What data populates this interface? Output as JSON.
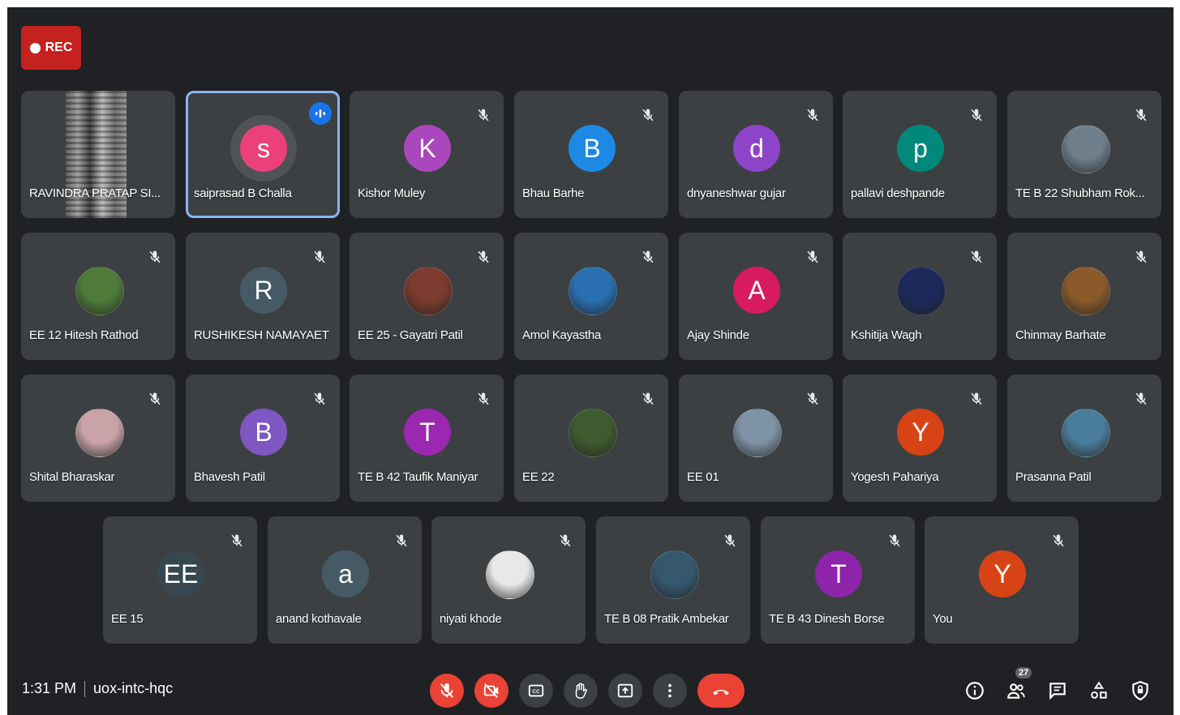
{
  "recording": {
    "label": "REC"
  },
  "participants": [
    {
      "name": "RAVINDRA PRATAP SI...",
      "type": "photo"
    },
    {
      "name": "saiprasad B Challa",
      "initial": "s",
      "color": "#ec407a",
      "speaking": true
    },
    {
      "name": "Kishor Muley",
      "initial": "K",
      "color": "#ab47bc"
    },
    {
      "name": "Bhau Barhe",
      "initial": "B",
      "color": "#1e88e5"
    },
    {
      "name": "dnyaneshwar gujar",
      "initial": "d",
      "color": "#8e44c8"
    },
    {
      "name": "pallavi deshpande",
      "initial": "p",
      "color": "#00897b"
    },
    {
      "name": "TE B 22 Shubham Rok...",
      "type": "pic",
      "pic": "#6f7f8c"
    },
    {
      "name": "EE 12 Hitesh Rathod",
      "type": "pic",
      "pic": "#4e7a3a"
    },
    {
      "name": "RUSHIKESH NAMAYAET",
      "initial": "R",
      "color": "#455a64"
    },
    {
      "name": "EE 25 - Gayatri Patil",
      "type": "pic",
      "pic": "#7b3b2e"
    },
    {
      "name": "Amol Kayastha",
      "type": "pic",
      "pic": "#2a6fb0"
    },
    {
      "name": "Ajay Shinde",
      "initial": "A",
      "color": "#d81b60"
    },
    {
      "name": "Kshitija Wagh",
      "type": "pic",
      "pic": "#1b2a5a"
    },
    {
      "name": "Chinmay Barhate",
      "type": "pic",
      "pic": "#8a5a2b"
    },
    {
      "name": "Shital Bharaskar",
      "type": "pic",
      "pic": "#c9a3a8"
    },
    {
      "name": "Bhavesh Patil",
      "initial": "B",
      "color": "#7e57c2"
    },
    {
      "name": "TE B 42 Taufik Maniyar",
      "initial": "T",
      "color": "#9c27b0"
    },
    {
      "name": "EE 22",
      "type": "pic",
      "pic": "#3e5a2f"
    },
    {
      "name": "EE 01",
      "type": "pic",
      "pic": "#7f93a6"
    },
    {
      "name": "Yogesh Pahariya",
      "initial": "Y",
      "color": "#d84315"
    },
    {
      "name": "Prasanna Patil",
      "type": "pic",
      "pic": "#4a7d9a"
    },
    {
      "name": "EE 15",
      "initial": "EE",
      "color": "#37474f"
    },
    {
      "name": "anand kothavale",
      "initial": "a",
      "color": "#455a64"
    },
    {
      "name": "niyati khode",
      "type": "pic",
      "pic": "#e8e8e8"
    },
    {
      "name": "TE B 08 Pratik Ambekar",
      "type": "pic",
      "pic": "#35586e"
    },
    {
      "name": "TE B 43 Dinesh Borse",
      "initial": "T",
      "color": "#8e24aa"
    },
    {
      "name": "You",
      "initial": "Y",
      "color": "#d84315"
    }
  ],
  "footer": {
    "time": "1:31 PM",
    "meeting_code": "uox-intc-hqc",
    "participant_count": "27"
  },
  "controls": [
    "mic-off-icon",
    "camera-off-icon",
    "captions-icon",
    "raise-hand-icon",
    "present-icon",
    "more-icon",
    "leave-call-icon"
  ],
  "right_controls": [
    "info-icon",
    "people-icon",
    "chat-icon",
    "activities-icon",
    "host-controls-icon"
  ]
}
